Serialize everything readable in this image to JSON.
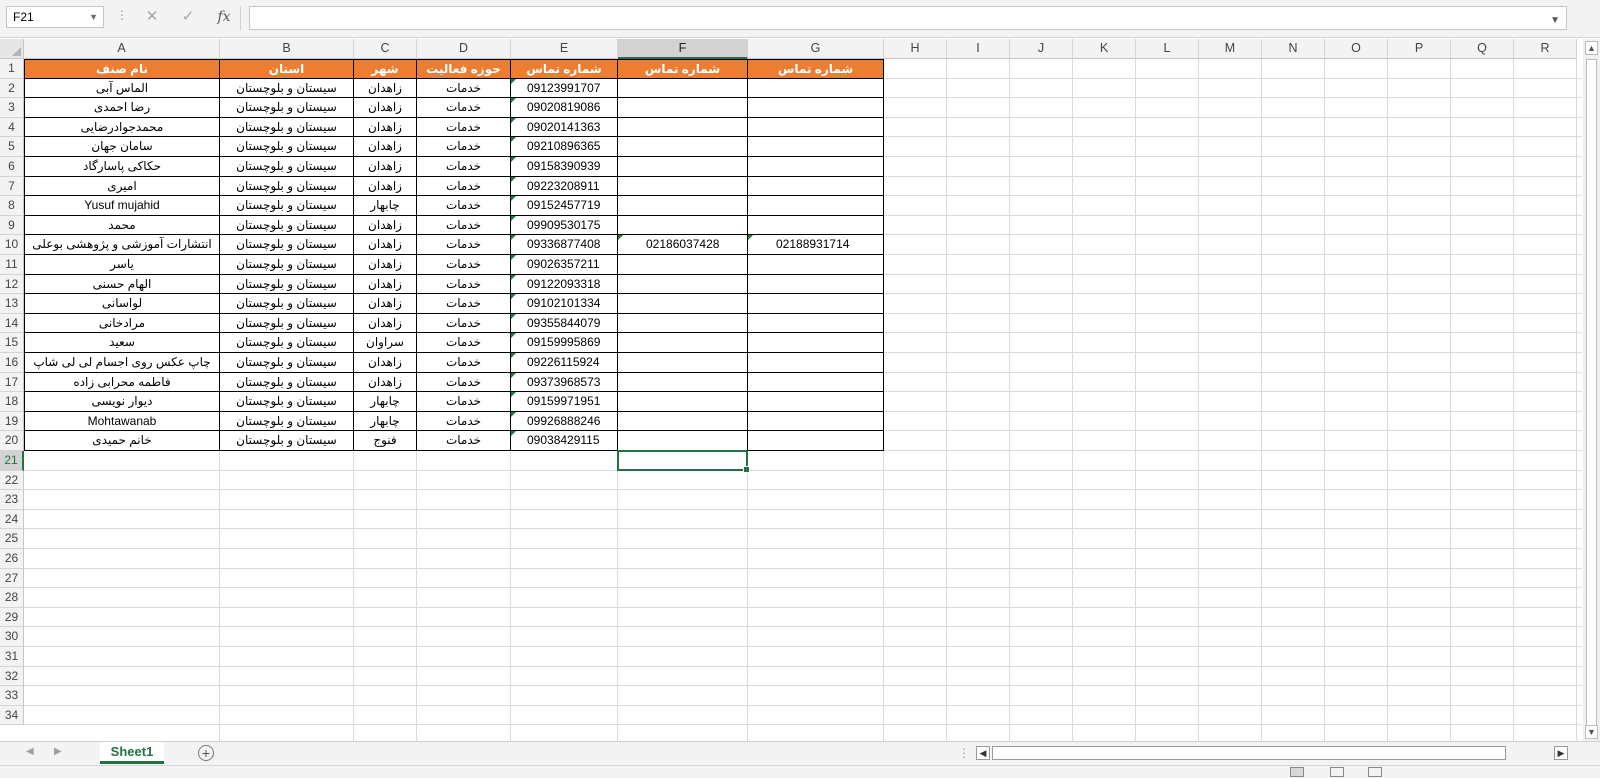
{
  "formula_bar": {
    "name_box": "F21",
    "formula": "",
    "cancel_icon": "✕",
    "enter_icon": "✓",
    "fx_label": "fx"
  },
  "columns": [
    "A",
    "B",
    "C",
    "D",
    "E",
    "F",
    "G",
    "H",
    "I",
    "J",
    "K",
    "L",
    "M",
    "N",
    "O",
    "P",
    "Q",
    "R"
  ],
  "selected_cell": "F21",
  "row_count": 34,
  "table": {
    "headers": [
      "نام صنف",
      "استان",
      "شهر",
      "حوزه فعالیت",
      "شماره تماس",
      "شماره تماس",
      "شماره تماس"
    ],
    "rows": [
      [
        "الماس آبی",
        "سیستان و بلوچستان",
        "زاهدان",
        "خدمات",
        "09123991707",
        "",
        ""
      ],
      [
        "رضا احمدی",
        "سیستان و بلوچستان",
        "زاهدان",
        "خدمات",
        "09020819086",
        "",
        ""
      ],
      [
        "محمدجوادرضایی",
        "سیستان و بلوچستان",
        "زاهدان",
        "خدمات",
        "09020141363",
        "",
        ""
      ],
      [
        "سامان جهان",
        "سیستان و بلوچستان",
        "زاهدان",
        "خدمات",
        "09210896365",
        "",
        ""
      ],
      [
        "حکاکی پاسارگاد",
        "سیستان و بلوچستان",
        "زاهدان",
        "خدمات",
        "09158390939",
        "",
        ""
      ],
      [
        "امیری",
        "سیستان و بلوچستان",
        "زاهدان",
        "خدمات",
        "09223208911",
        "",
        ""
      ],
      [
        "Yusuf mujahid",
        "سیستان و بلوچستان",
        "چابهار",
        "خدمات",
        "09152457719",
        "",
        ""
      ],
      [
        "محمد",
        "سیستان و بلوچستان",
        "زاهدان",
        "خدمات",
        "09909530175",
        "",
        ""
      ],
      [
        "انتشارات آموزشی و پژوهشی بوعلی",
        "سیستان و بلوچستان",
        "زاهدان",
        "خدمات",
        "09336877408",
        "02186037428",
        "02188931714"
      ],
      [
        "یاسر",
        "سیستان و بلوچستان",
        "زاهدان",
        "خدمات",
        "09026357211",
        "",
        ""
      ],
      [
        "الهام حسنی",
        "سیستان و بلوچستان",
        "زاهدان",
        "خدمات",
        "09122093318",
        "",
        ""
      ],
      [
        "لواسانی",
        "سیستان و بلوچستان",
        "زاهدان",
        "خدمات",
        "09102101334",
        "",
        ""
      ],
      [
        "مرادخانی",
        "سیستان و بلوچستان",
        "زاهدان",
        "خدمات",
        "09355844079",
        "",
        ""
      ],
      [
        "سعید",
        "سیستان و بلوچستان",
        "سراوان",
        "خدمات",
        "09159995869",
        "",
        ""
      ],
      [
        "چاپ عکس روی اجسام لی لی شاپ",
        "سیستان و بلوچستان",
        "زاهدان",
        "خدمات",
        "09226115924",
        "",
        ""
      ],
      [
        "فاطمه محرابی زاده",
        "سیستان و بلوچستان",
        "زاهدان",
        "خدمات",
        "09373968573",
        "",
        ""
      ],
      [
        "دیوار نویسی",
        "سیستان و بلوچستان",
        "چابهار",
        "خدمات",
        "09159971951",
        "",
        ""
      ],
      [
        "Mohtawanab",
        "سیستان و بلوچستان",
        "چابهار",
        "خدمات",
        "09926888246",
        "",
        ""
      ],
      [
        "خانم حمیدی",
        "سیستان و بلوچستان",
        "فنوج",
        "خدمات",
        "09038429115",
        "",
        ""
      ]
    ]
  },
  "sheet_tabs": [
    "Sheet1"
  ],
  "colors": {
    "header_fill": "#ed7d31",
    "accent": "#217346"
  },
  "icons": {
    "add_sheet": "plus-circle-icon",
    "scroll_left": "chevron-left-icon",
    "scroll_right": "chevron-right-icon"
  }
}
